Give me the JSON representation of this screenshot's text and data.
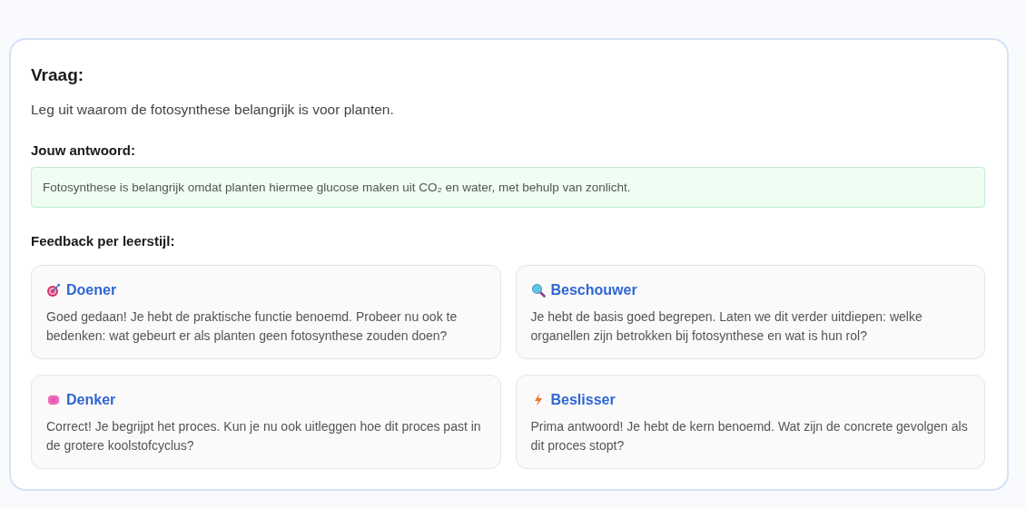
{
  "question": {
    "heading": "Vraag:",
    "text": "Leg uit waarom de fotosynthese belangrijk is voor planten."
  },
  "answer": {
    "label": "Jouw antwoord:",
    "text": "Fotosynthese is belangrijk omdat planten hiermee glucose maken uit CO₂ en water, met behulp van zonlicht."
  },
  "feedback": {
    "label": "Feedback per leerstijl:",
    "styles": [
      {
        "kind": "target",
        "name": "Doener",
        "text": "Goed gedaan! Je hebt de praktische functie benoemd. Probeer nu ook te bedenken: wat gebeurt er als planten geen fotosynthese zouden doen?"
      },
      {
        "kind": "magnifier",
        "name": "Beschouwer",
        "text": "Je hebt de basis goed begrepen. Laten we dit verder uitdiepen: welke organellen zijn betrokken bij fotosynthese en wat is hun rol?"
      },
      {
        "kind": "brain",
        "name": "Denker",
        "text": "Correct! Je begrijpt het proces. Kun je nu ook uitleggen hoe dit proces past in de grotere koolstofcyclus?"
      },
      {
        "kind": "lightning",
        "name": "Beslisser",
        "text": "Prima antwoord! Je hebt de kern benoemd. Wat zijn de concrete gevolgen als dit proces stopt?"
      }
    ]
  }
}
